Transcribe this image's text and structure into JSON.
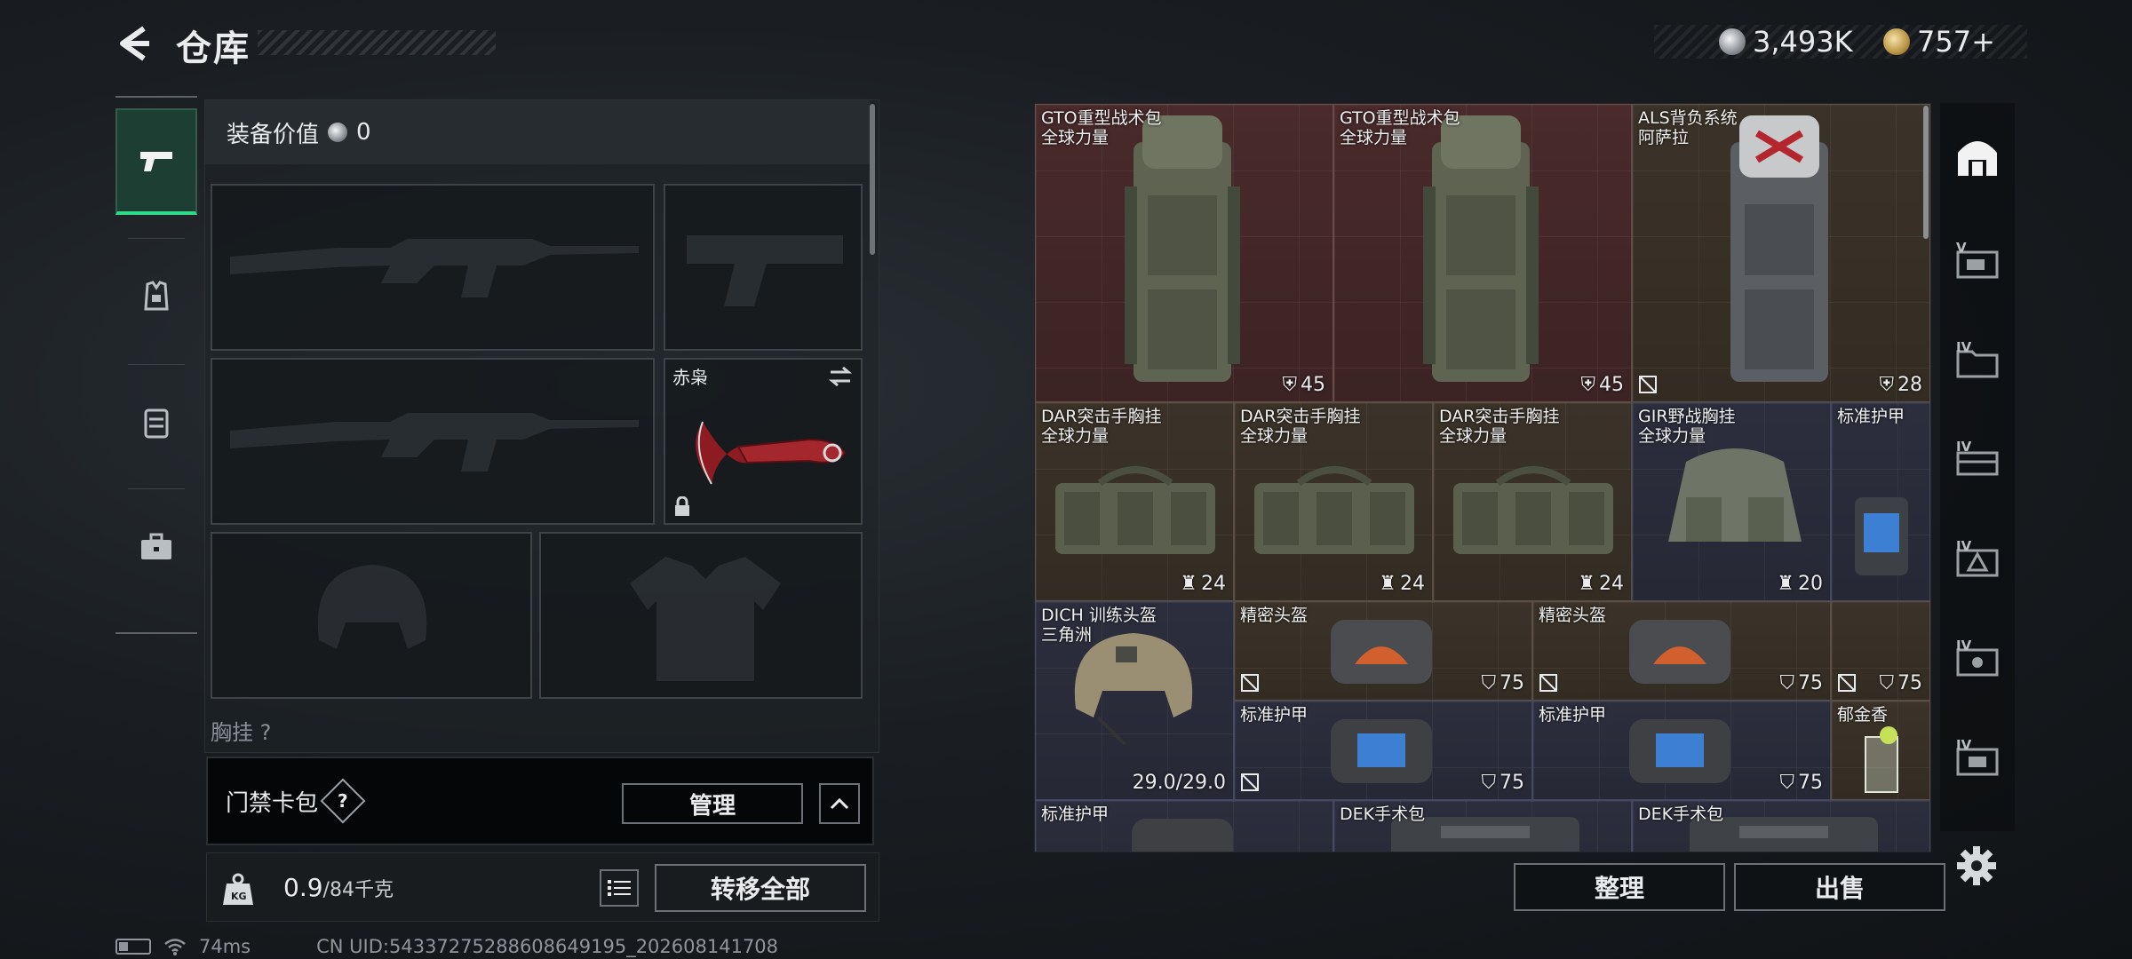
{
  "header": {
    "title": "仓库"
  },
  "currency": {
    "silver": "3,493K",
    "gold": "757+"
  },
  "loadout": {
    "equip_value_label": "装备价值",
    "equip_value": "0",
    "knife_name": "赤枭",
    "chest_label": "胸挂 ?"
  },
  "access_card": {
    "label": "门禁卡包",
    "help": "?",
    "manage": "管理"
  },
  "weight": {
    "value": "0.9",
    "max": "/84千克",
    "transfer_all": "转移全部"
  },
  "status_bar": {
    "ping": "74ms",
    "uid": "CN UID:543372752886086491​95_202608141708"
  },
  "inventory": {
    "items": [
      {
        "name": "GTO重型战术包",
        "sub": "全球力量",
        "badge": "45"
      },
      {
        "name": "GTO重型战术包",
        "sub": "全球力量",
        "badge": "45"
      },
      {
        "name": "ALS背负系统",
        "sub": "阿萨拉",
        "badge": "28"
      },
      {
        "name": "DAR突击手胸挂",
        "sub": "全球力量",
        "badge": "24"
      },
      {
        "name": "DAR突击手胸挂",
        "sub": "全球力量",
        "badge": "24"
      },
      {
        "name": "DAR突击手胸挂",
        "sub": "全球力量",
        "badge": "24"
      },
      {
        "name": "GIR野战胸挂",
        "sub": "全球力量",
        "badge": "20"
      },
      {
        "name": "标准护甲",
        "sub": "",
        "badge": ""
      },
      {
        "name": "DICH 训练头盔",
        "sub": "三角洲",
        "badge": "29.0/29.0"
      },
      {
        "name": "精密头盔",
        "sub": "",
        "badge": "75"
      },
      {
        "name": "精密头盔",
        "sub": "",
        "badge": "75"
      },
      {
        "name": "",
        "sub": "",
        "badge": "75"
      },
      {
        "name": "标准护甲",
        "sub": "",
        "badge": "75"
      },
      {
        "name": "标准护甲",
        "sub": "",
        "badge": "75"
      },
      {
        "name": "郁金香",
        "sub": "",
        "badge": ""
      },
      {
        "name": "标准护甲",
        "sub": "",
        "badge": ""
      },
      {
        "name": "DEK手术包",
        "sub": "",
        "badge": ""
      },
      {
        "name": "DEK手术包",
        "sub": "",
        "badge": ""
      }
    ],
    "sort": "整理",
    "sell": "出售"
  },
  "right_sidebar": {
    "levels": [
      "V",
      "IV",
      "IV",
      "IV",
      "IV",
      "IV"
    ]
  },
  "colors": {
    "accent_green": "#2fd98a",
    "red_item": "#4a2a2b",
    "brown_item": "#3b3329",
    "navy_item": "#2c2e3d"
  }
}
